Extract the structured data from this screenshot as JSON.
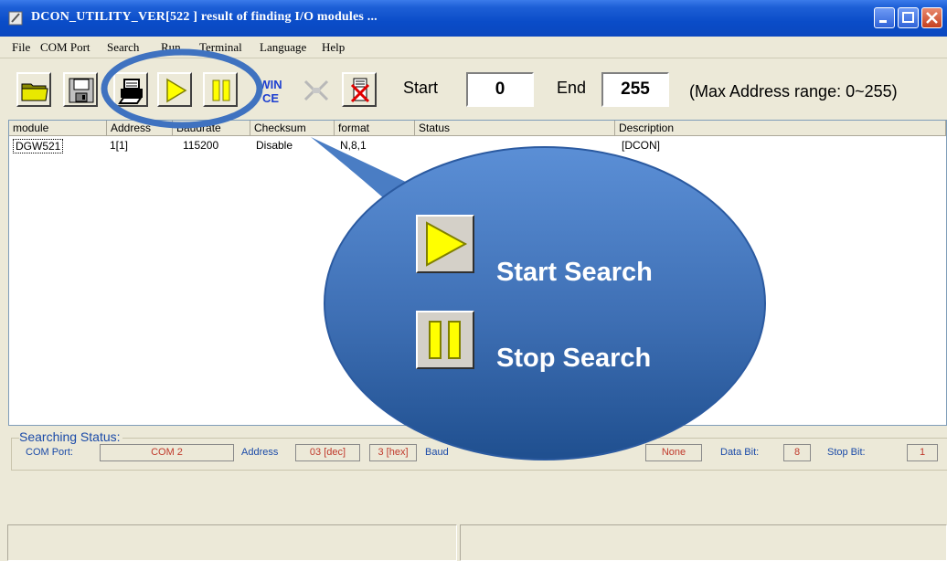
{
  "window": {
    "title": "DCON_UTILITY_VER[522  ] result of finding I/O modules ..."
  },
  "menu": [
    "File",
    "COM Port",
    "Search",
    "Run",
    "Terminal",
    "Language",
    "Help"
  ],
  "toolbar": {
    "start_label": "Start",
    "start_value": "0",
    "end_label": "End",
    "end_value": "255",
    "range_note": "(Max Address range: 0~255)",
    "wince_text_line1": "WIN",
    "wince_text_line2": "CE"
  },
  "list": {
    "columns": [
      "module",
      "Address",
      "Baudrate",
      "Checksum",
      "format",
      "Status",
      "Description"
    ],
    "rows": [
      {
        "module": "DGW521",
        "address": "1[1]",
        "baudrate": "115200",
        "checksum": "Disable",
        "format": "N,8,1",
        "status": "",
        "description": "[DCON]"
      }
    ]
  },
  "search_status": {
    "title": "Searching Status:",
    "com_port_label": "COM Port:",
    "com_port_value": "COM 2",
    "address_label": "Address",
    "address_dec": "03 [dec]",
    "address_hex": "3 [hex]",
    "baud_label": "Baud",
    "parity_value": "None",
    "data_bit_label": "Data Bit:",
    "data_bit_value": "8",
    "stop_bit_label": "Stop Bit:",
    "stop_bit_value": "1"
  },
  "callout": {
    "start_search": "Start Search",
    "stop_search": "Stop Search"
  },
  "colors": {
    "titlebar": "#0a4cc8",
    "highlight_ring": "#3f72c0",
    "callout_fill_top": "#5b8fd6",
    "callout_fill_bottom": "#1f4f8f",
    "play_yellow": "#ffff00"
  },
  "icons": [
    "open-folder-icon",
    "save-disk-icon",
    "print-icon",
    "play-icon",
    "pause-icon",
    "wince-icon",
    "network-icon",
    "stop-module-icon"
  ]
}
